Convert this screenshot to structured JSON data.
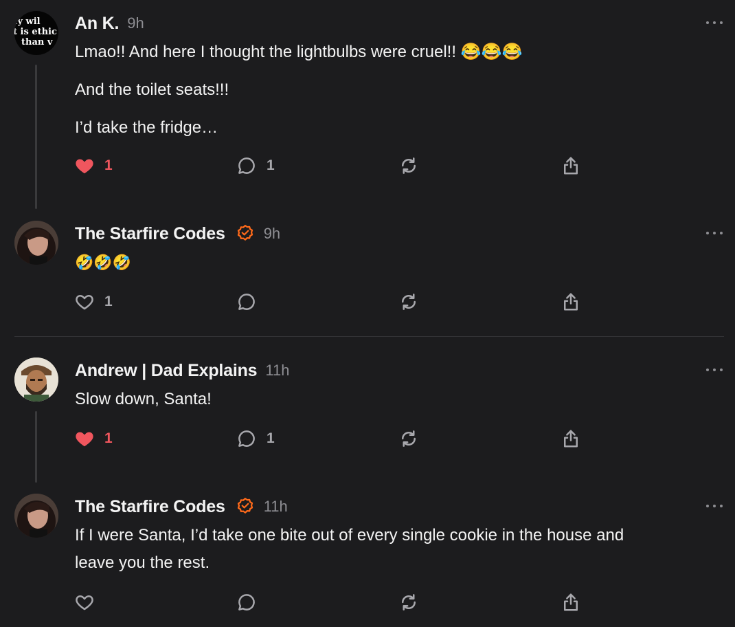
{
  "posts": [
    {
      "author": "An K.",
      "time": "9h",
      "avatar_text": [
        "ay wil",
        "t is ethic",
        "than v"
      ],
      "lines": [
        "Lmao!! And here I thought the lightbulbs were cruel!! 😂😂😂",
        "And the toilet seats!!!",
        "I’d take the fridge…"
      ],
      "likes": "1",
      "liked": true,
      "replies": "1"
    },
    {
      "author": "The Starfire Codes",
      "time": "9h",
      "verified": true,
      "lines": [
        "🤣🤣🤣"
      ],
      "likes": "1",
      "liked": false,
      "replies": ""
    },
    {
      "author": "Andrew | Dad Explains",
      "time": "11h",
      "lines": [
        "Slow down, Santa!"
      ],
      "likes": "1",
      "liked": true,
      "replies": "1"
    },
    {
      "author": "The Starfire Codes",
      "time": "11h",
      "verified": true,
      "lines": [
        "If I were Santa, I’d take one bite out of every single cookie in the house and",
        "leave you the rest."
      ],
      "likes": "",
      "liked": false,
      "replies": ""
    }
  ],
  "colors": {
    "background": "#1c1c1e",
    "like_active": "#f0565e",
    "verified": "#ff6a1a",
    "muted": "#8e8e93"
  },
  "icons": [
    "heart-icon",
    "comment-icon",
    "repost-icon",
    "share-icon",
    "more-icon",
    "verified-badge-icon"
  ]
}
